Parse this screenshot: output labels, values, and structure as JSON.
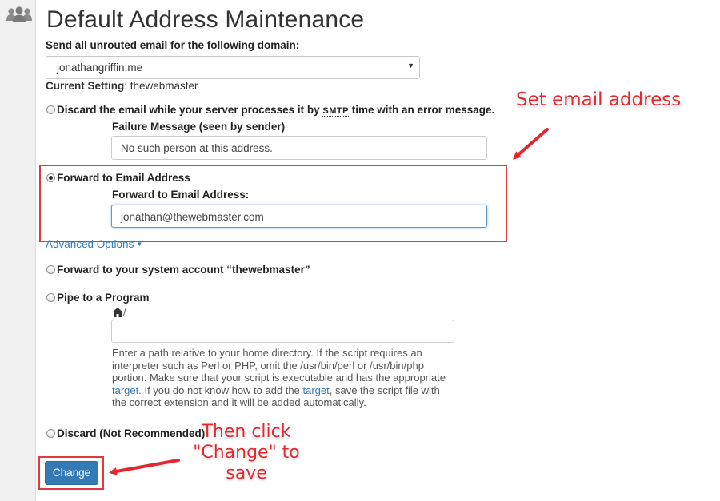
{
  "sidebar": {
    "icon": "users-icon"
  },
  "page": {
    "title": "Default Address Maintenance"
  },
  "domain_section": {
    "label": "Send all unrouted email for the following domain:",
    "selected_domain": "jonathangriffin.me",
    "current_setting_label": "Current Setting",
    "current_setting_value": ": thewebmaster"
  },
  "options": {
    "discard_message": {
      "label_before": "Discard the email while your server processes it by ",
      "label_abbr": "SMTP",
      "label_after": " time with an error message.",
      "field_label": "Failure Message (seen by sender)",
      "field_value": "No such person at this address.",
      "selected": false
    },
    "forward_email": {
      "label": "Forward to Email Address",
      "field_label": "Forward to Email Address:",
      "field_value": "jonathan@thewebmaster.com",
      "selected": true
    },
    "advanced_options": "Advanced Options",
    "forward_system": {
      "label": "Forward to your system account “thewebmaster”",
      "selected": false
    },
    "pipe_program": {
      "label": "Pipe to a Program",
      "home_icon": "home-icon",
      "path_prefix": "/",
      "field_value": "",
      "help_part1": "Enter a path relative to your home directory. If the script requires an interpreter such as Perl or PHP, omit the /usr/bin/perl or /usr/bin/php portion. Make sure that your script is executable and has the appropriate ",
      "help_link1": "target",
      "help_part2": ". If you do not know how to add the ",
      "help_link2": "target",
      "help_part3": ", save the script file with the correct extension and it will be added automatically.",
      "selected": false
    },
    "discard_not_recommended": {
      "label": "Discard (Not Recommended)",
      "selected": false
    }
  },
  "actions": {
    "change_label": "Change"
  },
  "annotations": {
    "note1": "Set email address",
    "note2_line1": "Then click",
    "note2_line2": "\"Change\" to",
    "note2_line3": "save",
    "color": "#e5262c"
  },
  "colors": {
    "primary": "#337ab7",
    "annotation": "#e0393e"
  }
}
